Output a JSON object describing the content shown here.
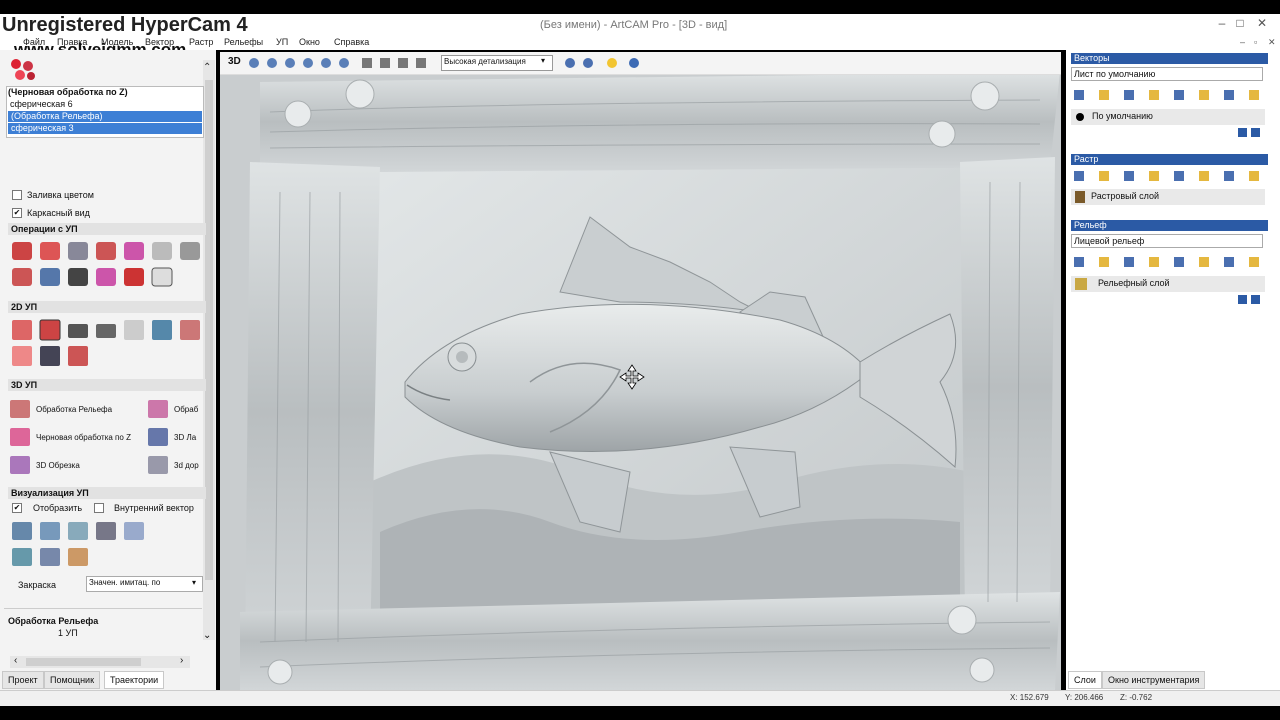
{
  "overlay": {
    "watermark": "Unregistered HyperCam 4",
    "site": "www.solveigmm.com"
  },
  "window": {
    "title": "(Без имени) - ArtCAM Pro - [3D - вид]"
  },
  "menu": [
    "Файл",
    "Правка",
    "Модель",
    "Вектор",
    "Растр",
    "Рельефы",
    "УП",
    "Окно",
    "Справка"
  ],
  "toolpaths": {
    "tree": [
      "(Черновая обработка по Z)",
      "сферическая 6",
      "(Обработка Рельефа)",
      "сферическая 3"
    ],
    "fill_color": "Заливка цветом",
    "wireframe": "Каркасный вид",
    "sections": {
      "ops": "Операции с УП",
      "ops2d": "2D УП",
      "ops3d": "3D УП",
      "vis": "Визуализация УП"
    },
    "ops3d_items": [
      "Обработка Рельефа",
      "Обраб",
      "Черновая обработка по Z",
      "3D Ла",
      "3D Обрезка",
      "3d дор"
    ],
    "show": "Отобразить",
    "inner_vector": "Внутренний вектор",
    "shading_label": "Закраска",
    "shading_value": "Значен. имитац. по",
    "info_name": "Обработка Рельефа",
    "info_count": "1 УП"
  },
  "tabs": [
    "Проект",
    "Помощник",
    "Траектории"
  ],
  "view": {
    "mode": "3D",
    "detail": "Высокая детализация"
  },
  "right": {
    "vectors_title": "Векторы",
    "vectors_sheet": "Лист по умолчанию",
    "vectors_layer": "По умолчанию",
    "raster_title": "Растр",
    "raster_layer": "Растровый слой",
    "relief_title": "Рельеф",
    "relief_value": "Лицевой рельеф",
    "relief_layer": "Рельефный слой",
    "tabs": [
      "Слои",
      "Окно инструментария"
    ]
  },
  "status": {
    "x": "X: 152.679",
    "y": "Y: 206.466",
    "z": "Z: -0.762"
  },
  "colors": {
    "accent": "#2b5aa5",
    "selection": "#3d7fd5"
  }
}
